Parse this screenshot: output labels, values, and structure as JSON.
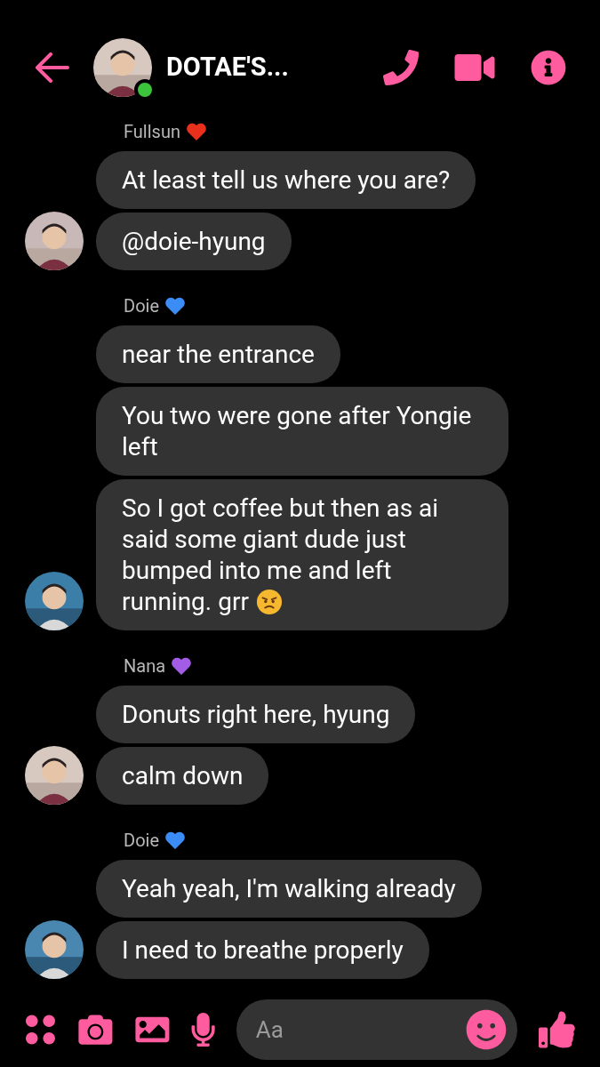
{
  "header": {
    "title": "DOTAE'S...",
    "online": true
  },
  "groups": [
    {
      "sender": "Fullsun",
      "color": "#e8301c",
      "messages": [
        {
          "text": "At least tell us where you are?"
        },
        {
          "text": "@doie-hyung"
        }
      ]
    },
    {
      "sender": "Doie",
      "color": "#3b8cf5",
      "messages": [
        {
          "text": "near the entrance"
        },
        {
          "text": "You two were gone after Yongie left"
        },
        {
          "text": "So I got coffee but then as ai said some giant dude just bumped into me and left running. grr",
          "emoji": true
        }
      ]
    },
    {
      "sender": "Nana",
      "color": "#a35ce6",
      "messages": [
        {
          "text": "Donuts right here, hyung"
        },
        {
          "text": "calm down"
        }
      ]
    },
    {
      "sender": "Doie",
      "color": "#3b8cf5",
      "messages": [
        {
          "text": "Yeah yeah, I'm walking already"
        },
        {
          "text": "I need to breathe properly"
        }
      ]
    }
  ],
  "composer": {
    "placeholder": "Aa"
  }
}
